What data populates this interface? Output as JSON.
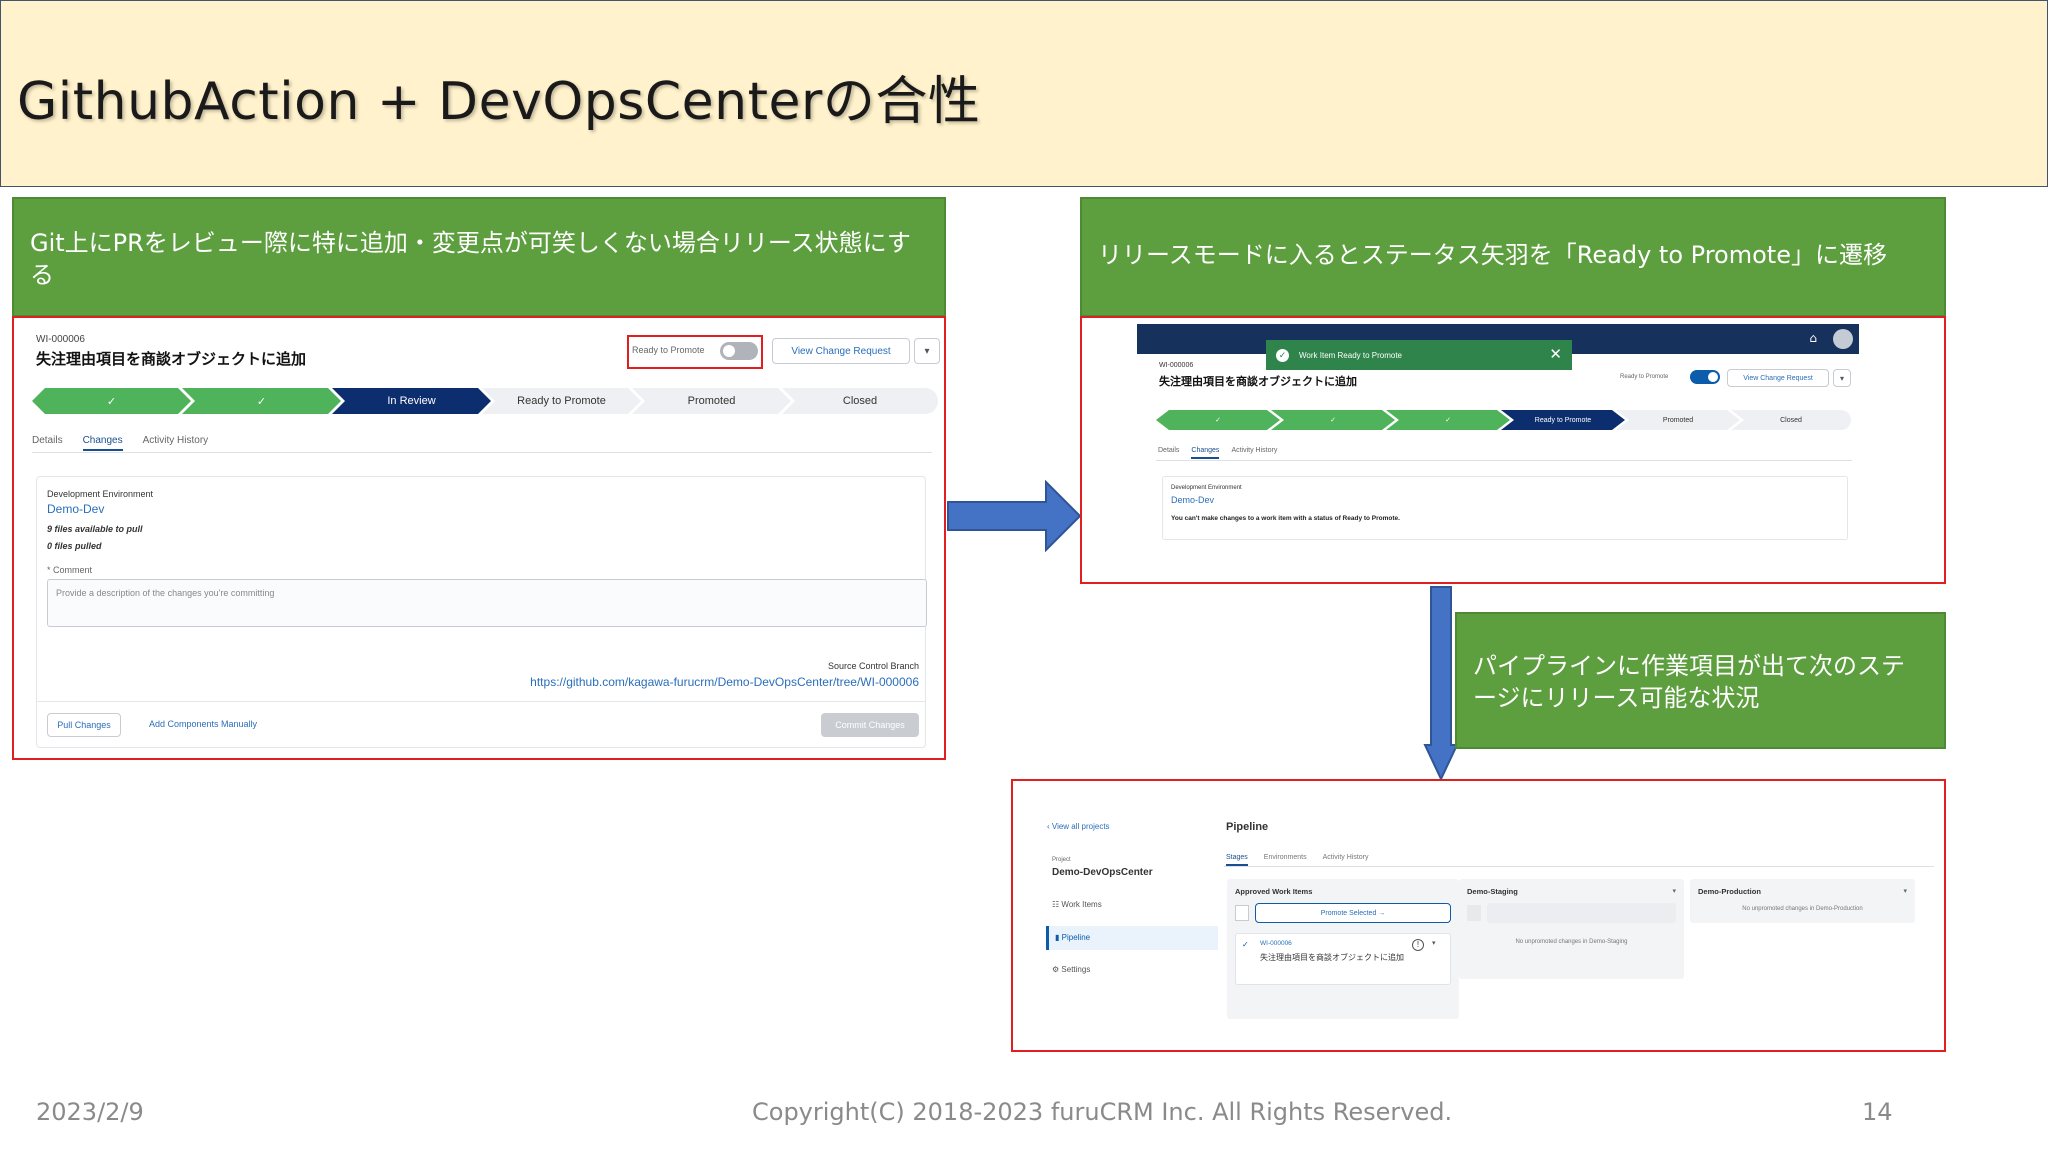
{
  "slide": {
    "title": "GithubAction + DevOpsCenterの合性",
    "date": "2023/2/9",
    "copyright": "Copyright(C) 2018-2023 furuCRM Inc.  All Rights Reserved.",
    "page_number": "14"
  },
  "callouts": {
    "step1": "Git上にPRをレビュー際に特に追加・変更点が可笑しくない場合リリース状態にする",
    "step2": "リリースモードに入るとステータス矢羽を「Ready to Promote」に遷移",
    "step3": "パイプラインに作業項目が出て次のステージにリリース可能な状況"
  },
  "screenshot1": {
    "work_item_id": "WI-000006",
    "work_item_title": "失注理由項目を商談オブジェクトに追加",
    "ready_label": "Ready to Promote",
    "view_change_request": "View Change Request",
    "stages": [
      {
        "label": "✓",
        "state": "done"
      },
      {
        "label": "✓",
        "state": "done"
      },
      {
        "label": "In Review",
        "state": "current"
      },
      {
        "label": "Ready to Promote",
        "state": "todo"
      },
      {
        "label": "Promoted",
        "state": "todo"
      },
      {
        "label": "Closed",
        "state": "todo"
      }
    ],
    "tabs": [
      "Details",
      "Changes",
      "Activity History"
    ],
    "dev_env_label": "Development Environment",
    "dev_env_value": "Demo-Dev",
    "files_available": "9 files available to pull",
    "files_pulled": "0 files pulled",
    "comment_label": "* Comment",
    "comment_placeholder": "Provide a description of the changes you're committing",
    "source_branch_label": "Source Control Branch",
    "source_branch_url": "https://github.com/kagawa-furucrm/Demo-DevOpsCenter/tree/WI-000006",
    "pull_changes": "Pull Changes",
    "add_components": "Add Components Manually",
    "commit_changes": "Commit Changes"
  },
  "screenshot2": {
    "toast": "Work Item Ready to Promote",
    "work_item_id": "WI-000006",
    "work_item_title": "失注理由項目を商談オブジェクトに追加",
    "ready_label": "Ready to Promote",
    "view_change_request": "View Change Request",
    "stages": [
      {
        "label": "✓",
        "state": "done"
      },
      {
        "label": "✓",
        "state": "done"
      },
      {
        "label": "✓",
        "state": "done"
      },
      {
        "label": "Ready to Promote",
        "state": "current"
      },
      {
        "label": "Promoted",
        "state": "todo"
      },
      {
        "label": "Closed",
        "state": "todo"
      }
    ],
    "tabs": [
      "Details",
      "Changes",
      "Activity History"
    ],
    "dev_env_label": "Development Environment",
    "dev_env_value": "Demo-Dev",
    "notice": "You can't make changes to a work item with a status of Ready to Promote."
  },
  "screenshot3": {
    "back_link": "View all projects",
    "project_label": "Project",
    "project_name": "Demo-DevOpsCenter",
    "nav": [
      "Work Items",
      "Pipeline",
      "Settings"
    ],
    "page_title": "Pipeline",
    "tabs": [
      "Stages",
      "Environments",
      "Activity History"
    ],
    "columns": [
      {
        "title": "Approved Work Items"
      },
      {
        "title": "Demo-Staging",
        "empty": "No unpromoted changes in Demo-Staging"
      },
      {
        "title": "Demo-Production",
        "empty": "No unpromoted changes in Demo-Production"
      }
    ],
    "promote_selected": "Promote Selected  →",
    "card_id": "WI-000006",
    "card_title": "失注理由項目を商談オブジェクトに追加"
  },
  "colors": {
    "title_bg": "#fff2cc",
    "callout_green": "#5d9e3f",
    "frame_red": "#e02020",
    "arrow_blue": "#4472c4",
    "stage_done": "#4fb35b",
    "stage_current": "#0d2e6e"
  }
}
